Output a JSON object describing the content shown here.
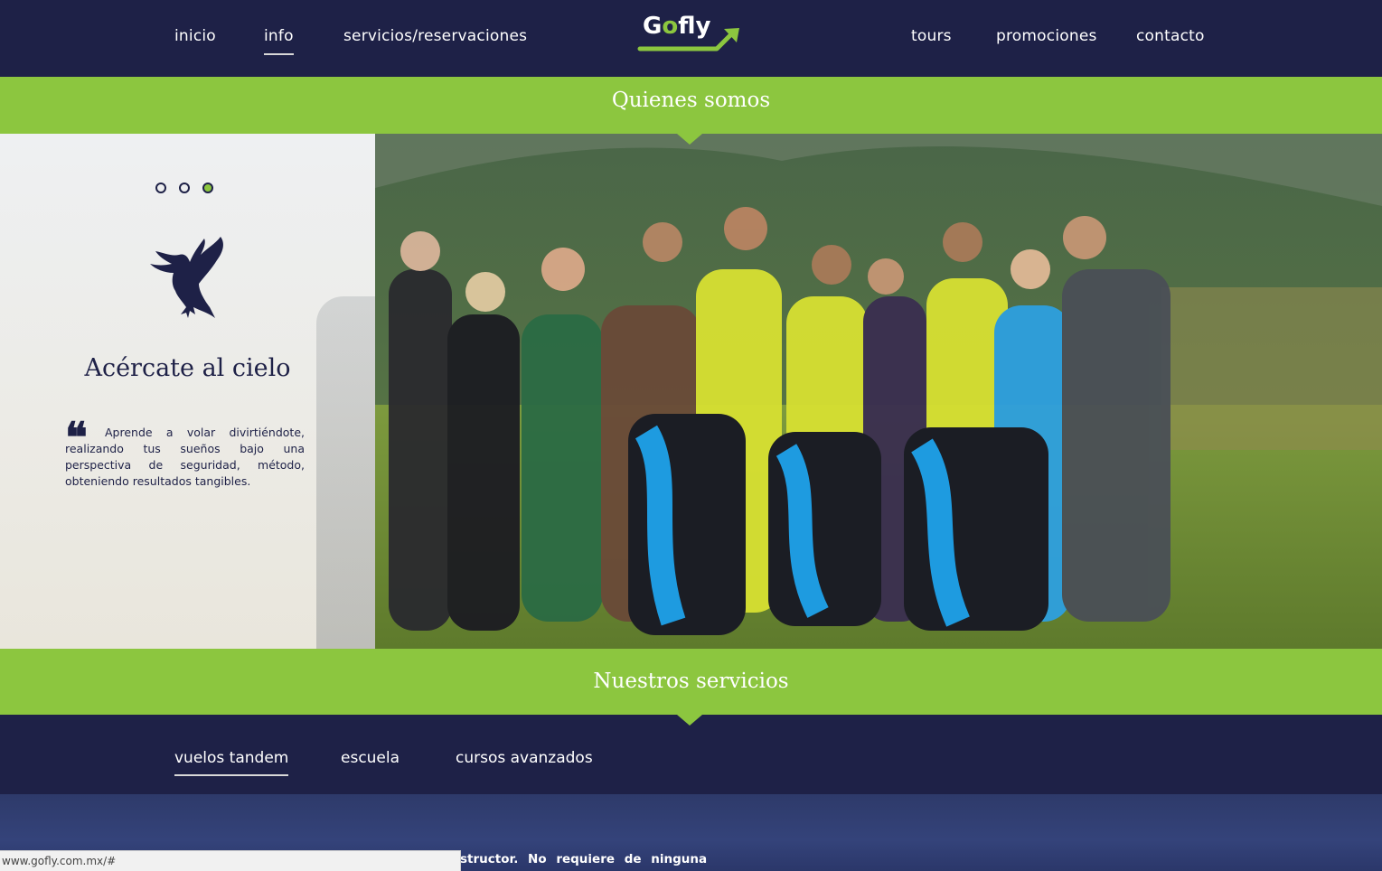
{
  "nav": {
    "items": [
      {
        "label": "inicio",
        "active": false
      },
      {
        "label": "info",
        "active": true
      },
      {
        "label": "servicios/reservaciones",
        "active": false
      },
      {
        "label": "tours",
        "active": false
      },
      {
        "label": "promociones",
        "active": false
      },
      {
        "label": "contacto",
        "active": false
      }
    ],
    "logo": {
      "prefix": "G",
      "accent": "o",
      "suffix": "fly"
    }
  },
  "section_about": {
    "title": "Quienes somos"
  },
  "hero": {
    "slider_dots": [
      {
        "active": false
      },
      {
        "active": false
      },
      {
        "active": true
      }
    ],
    "icon": "bird-icon",
    "title": "Acércate al cielo",
    "quote_mark": "❝",
    "text": "Aprende a volar divirtiéndote, realizando tus sueños bajo una perspectiva de seguridad, método, obteniendo resultados tangibles."
  },
  "section_services": {
    "title": "Nuestros servicios",
    "tabs": [
      {
        "label": "vuelos tandem",
        "active": true
      },
      {
        "label": "escuela",
        "active": false
      },
      {
        "label": "cursos avanzados",
        "active": false
      }
    ],
    "partial_text": "structor. No requiere de ninguna"
  },
  "status_bar": {
    "url": "www.gofly.com.mx/#"
  },
  "colors": {
    "navy": "#1e2147",
    "green": "#8cc63f",
    "white": "#ffffff"
  }
}
